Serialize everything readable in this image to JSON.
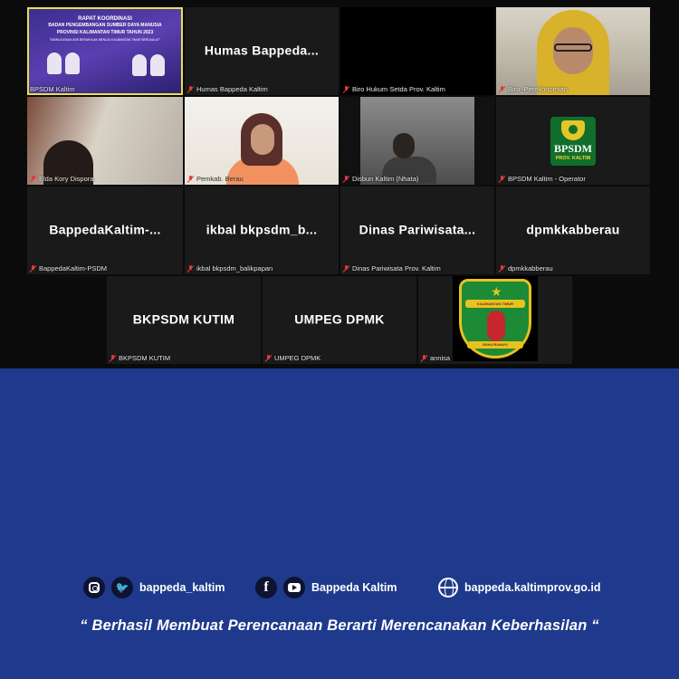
{
  "meeting": {
    "tiles": [
      {
        "name": "BPSDM Kaltim",
        "big": ""
      },
      {
        "name": "Humas Bappeda Kaltim",
        "big": "Humas  Bappeda..."
      },
      {
        "name": "Biro Hukum Setda Prov. Kaltim",
        "big": ""
      },
      {
        "name": "Biro_Perekonomian",
        "big": ""
      },
      {
        "name": "Elda Kory Dispora",
        "big": ""
      },
      {
        "name": "Pemkab. Berau",
        "big": ""
      },
      {
        "name": "Disbun Kaltim (Nhata)",
        "big": ""
      },
      {
        "name": "BPSDM Kaltim - Operator",
        "big": ""
      },
      {
        "name": "BappedaKaltim-PSDM",
        "big": "BappedaKaltim-..."
      },
      {
        "name": "ikbal bkpsdm_balikpapan",
        "big": "ikbal  bkpsdm_b..."
      },
      {
        "name": "Dinas Pariwisata Prov. Kaltim",
        "big": "Dinas  Pariwisata..."
      },
      {
        "name": "dpmkkabberau",
        "big": "dpmkkabberau"
      },
      {
        "name": "BKPSDM KUTIM",
        "big": "BKPSDM KUTIM"
      },
      {
        "name": "UMPEG DPMK",
        "big": "UMPEG DPMK"
      },
      {
        "name": "annisa",
        "big": ""
      }
    ],
    "slide": {
      "line1": "RAPAT KOORDINASI",
      "line2": "BADAN PENGEMBANGAN SUMBER DAYA MANUSIA",
      "line3": "PROVINSI KALIMANTAN TIMUR TAHUN 2023",
      "line4": "\"MEWUJUDKAN ASN BERAKHLAK MENUJU KALIMANTAN TIMUR BERDAULAT\""
    },
    "bpsdm_logo": {
      "title": "BPSDM",
      "subtitle": "PROV. KALTIM"
    },
    "emblem": {
      "ribbon": "KALIMANTAN TIMUR",
      "band": "RUHUI RAHAYU"
    }
  },
  "footer": {
    "instagram_icon": "instagram-icon",
    "twitter_icon": "twitter-icon",
    "twitter_handle": "bappeda_kaltim",
    "facebook_icon": "facebook-icon",
    "youtube_icon": "youtube-icon",
    "channel_name": "Bappeda Kaltim",
    "globe_icon": "globe-icon",
    "website": "bappeda.kaltimprov.go.id",
    "tagline": "“ Berhasil  Membuat Perencanaan Berarti Merencanakan Keberhasilan “"
  },
  "colors": {
    "background": "#1f3a8c",
    "meeting_bg": "#0b0b0b",
    "active_speaker": "#e8e04a",
    "mute": "#e03b3b"
  }
}
